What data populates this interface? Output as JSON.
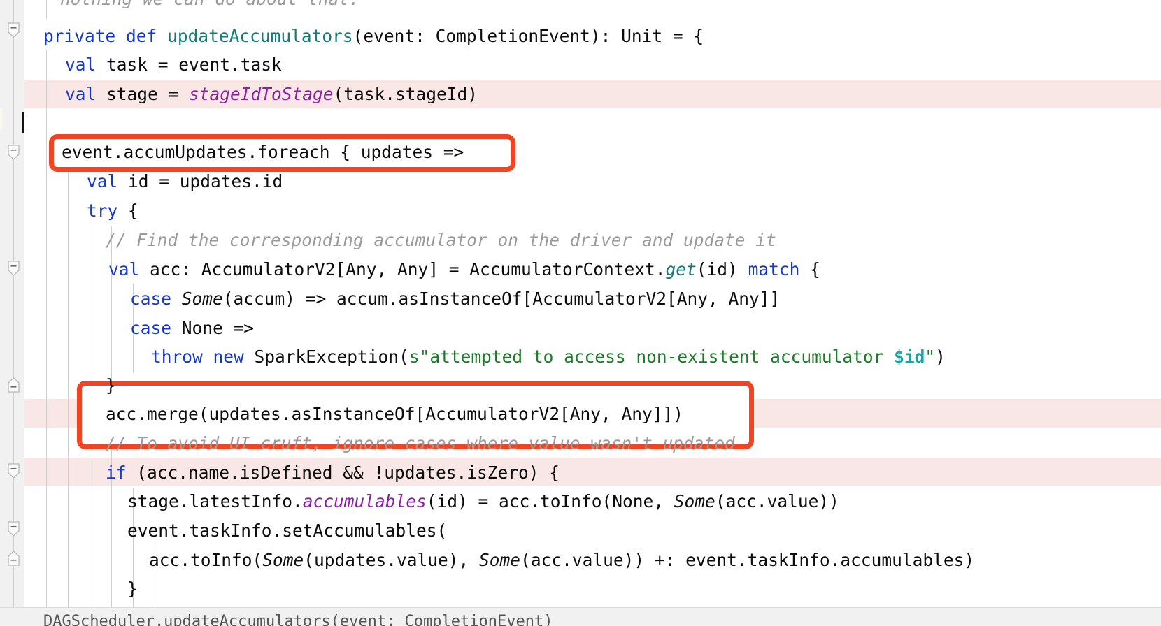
{
  "app": {
    "kind": "code-editor",
    "language": "Scala",
    "accent_red": "#ee4526",
    "highlight_pink": "#f8e7e4",
    "highlight_caret_line": "#fbfaee",
    "gutter_bg": "#f1f1f1",
    "background": "#ffffff"
  },
  "code": {
    "lines": [
      {
        "id": "l0",
        "indent": 0,
        "text": "nothing we can do about that.",
        "clipped": true
      },
      {
        "id": "l1",
        "indent": 0,
        "text": "private def updateAccumulators(event: CompletionEvent): Unit = {"
      },
      {
        "id": "l2",
        "indent": 1,
        "text": "val task = event.task"
      },
      {
        "id": "l3",
        "indent": 1,
        "text": "val stage = stageIdToStage(task.stageId)"
      },
      {
        "id": "l4",
        "indent": 1,
        "text": ""
      },
      {
        "id": "l5",
        "indent": 1,
        "text": "event.accumUpdates.foreach { updates =>"
      },
      {
        "id": "l6",
        "indent": 2,
        "text": "val id = updates.id"
      },
      {
        "id": "l7",
        "indent": 2,
        "text": "try {"
      },
      {
        "id": "l8",
        "indent": 3,
        "text": "// Find the corresponding accumulator on the driver and update it"
      },
      {
        "id": "l9",
        "indent": 3,
        "text": "val acc: AccumulatorV2[Any, Any] = AccumulatorContext.get(id) match {"
      },
      {
        "id": "l10",
        "indent": 4,
        "text": "case Some(accum) => accum.asInstanceOf[AccumulatorV2[Any, Any]]"
      },
      {
        "id": "l11",
        "indent": 4,
        "text": "case None =>"
      },
      {
        "id": "l12",
        "indent": 5,
        "text": "throw new SparkException(s\"attempted to access non-existent accumulator $id\")"
      },
      {
        "id": "l13",
        "indent": 3,
        "text": "}"
      },
      {
        "id": "l14",
        "indent": 3,
        "text": "acc.merge(updates.asInstanceOf[AccumulatorV2[Any, Any]])"
      },
      {
        "id": "l15",
        "indent": 3,
        "text": "// To avoid UI cruft, ignore cases where value wasn't updated"
      },
      {
        "id": "l16",
        "indent": 3,
        "text": "if (acc.name.isDefined && !updates.isZero) {"
      },
      {
        "id": "l17",
        "indent": 4,
        "text": "stage.latestInfo.accumulables(id) = acc.toInfo(None, Some(acc.value))"
      },
      {
        "id": "l18",
        "indent": 4,
        "text": "event.taskInfo.setAccumulables("
      },
      {
        "id": "l19",
        "indent": 5,
        "text": "acc.toInfo(Some(updates.value), Some(acc.value)) +: event.taskInfo.accumulables)"
      },
      {
        "id": "l20",
        "indent": 4,
        "text": "}",
        "clipped": true
      }
    ]
  },
  "highlights": {
    "modified_lines": [
      "l3",
      "l14",
      "l16"
    ],
    "caret_line": "l4"
  },
  "annotations": {
    "boxes": [
      {
        "id": "box-1",
        "targets": [
          "l5"
        ],
        "label": "event.accumUpdates.foreach { updates =>"
      },
      {
        "id": "box-2",
        "targets": [
          "l13",
          "l14"
        ],
        "label": "acc.merge(updates.asInstanceOf[AccumulatorV2[Any, Any]])"
      }
    ]
  },
  "gutter": {
    "fold_markers": [
      {
        "id": "fold-1",
        "state": "expanded",
        "glyph": "minus"
      },
      {
        "id": "fold-2",
        "state": "expanded",
        "glyph": "minus"
      },
      {
        "id": "fold-3",
        "state": "expanded",
        "glyph": "minus"
      },
      {
        "id": "fold-4",
        "state": "expanded",
        "glyph": "minus"
      },
      {
        "id": "fold-5",
        "state": "collapsed-end",
        "glyph": "minus"
      },
      {
        "id": "fold-6",
        "state": "expanded",
        "glyph": "minus"
      },
      {
        "id": "fold-7",
        "state": "expanded",
        "glyph": "minus"
      },
      {
        "id": "fold-8",
        "state": "collapsed-end",
        "glyph": "minus"
      }
    ]
  },
  "statusbar": {
    "text": "DAGScheduler.updateAccumulators(event: CompletionEvent)"
  }
}
